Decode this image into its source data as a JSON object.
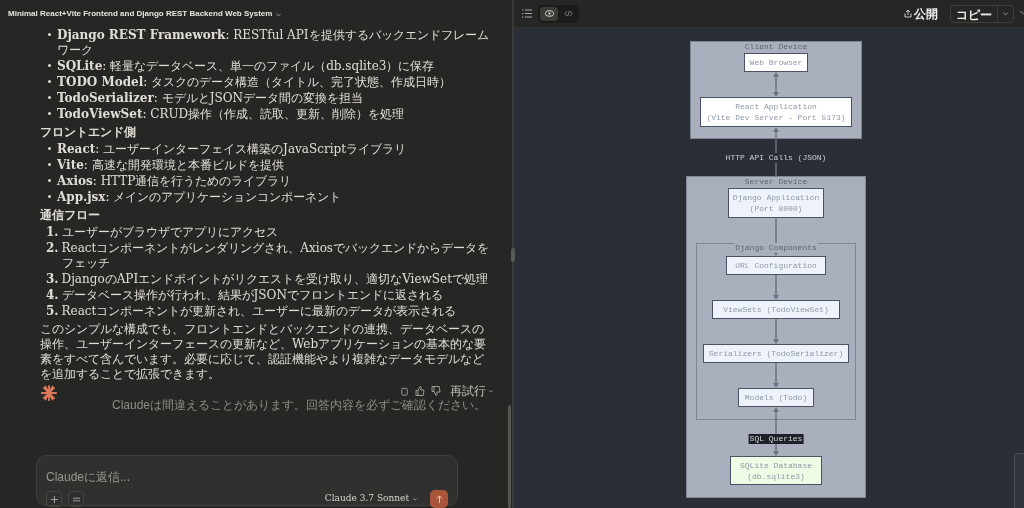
{
  "chat": {
    "title": "Minimal React+Vite Frontend and Django REST Backend Web System",
    "backend_items": [
      "**Django REST Framework**: RESTful APIを提供するバックエンドフレームワーク",
      "**SQLite**: 軽量なデータベース、単一のファイル（db.sqlite3）に保存",
      "**TODO Model**: タスクのデータ構造（タイトル、完了状態、作成日時）",
      "**TodoSerializer**: モデルとJSONデータ間の変換を担当",
      "**TodoViewSet**: CRUD操作（作成、読取、更新、削除）を処理"
    ],
    "frontend_heading": "フロントエンド側",
    "frontend_items": [
      "**React**: ユーザーインターフェイス構築のJavaScriptライブラリ",
      "**Vite**: 高速な開発環境と本番ビルドを提供",
      "**Axios**: HTTP通信を行うためのライブラリ",
      "**App.jsx**: メインのアプリケーションコンポーネント"
    ],
    "flow_heading": "通信フロー",
    "flow_steps": [
      {
        "number": "1.",
        "text": "ユーザーがブラウザでアプリにアクセス"
      },
      {
        "number": "2.",
        "text": "Reactコンポーネントがレンダリングされ、Axiosでバックエンドからデータをフェッチ"
      },
      {
        "number": "3.",
        "text": "DjangoのAPIエンドポイントがリクエストを受け取り、適切なViewSetで処理"
      },
      {
        "number": "4.",
        "text": "データベース操作が行われ、結果がJSONでフロントエンドに返される"
      },
      {
        "number": "5.",
        "text": "Reactコンポーネントが更新され、ユーザーに最新のデータが表示される"
      }
    ],
    "summary": "このシンプルな構成でも、フロントエンドとバックエンドの連携、データベースの操作、ユーザーインターフェースの更新など、Webアプリケーションの基本的な要素をすべて含んでいます。必要に応じて、認証機能やより複雑なデータモデルなどを追加することで拡張できます。",
    "retry_label": "再試行",
    "disclaimer": "Claudeは間違えることがあります。回答内容を必ずご確認ください。",
    "reply_placeholder": "Claudeに返信...",
    "model": "Claude 3.7 Sonnet"
  },
  "artifact": {
    "view_tabs": [
      {
        "kind": "preview",
        "selected": true
      },
      {
        "kind": "code",
        "selected": false
      }
    ],
    "publish_label": "公開",
    "copy_label": "コピー",
    "diagram": {
      "client_device": {
        "title": "Client Device",
        "browser": [
          "Web Browser"
        ],
        "react_app": [
          "React Application",
          "(Vite Dev Server - Port 5173)"
        ]
      },
      "http_label": "HTTP API Calls (JSON)",
      "server_device": {
        "title": "Server Device",
        "django_app": [
          "Django Application",
          "(Port 8000)"
        ],
        "components_title": "Django Components",
        "components": [
          [
            "URL Configuration"
          ],
          [
            "ViewSets (TodoViewSet)"
          ],
          [
            "Serializers (TodoSerializer)"
          ],
          [
            "Models (Todo)"
          ]
        ],
        "sql_label": "SQL Queries",
        "database": [
          "SQLite Database",
          "(db.sqlite3)"
        ]
      }
    }
  }
}
